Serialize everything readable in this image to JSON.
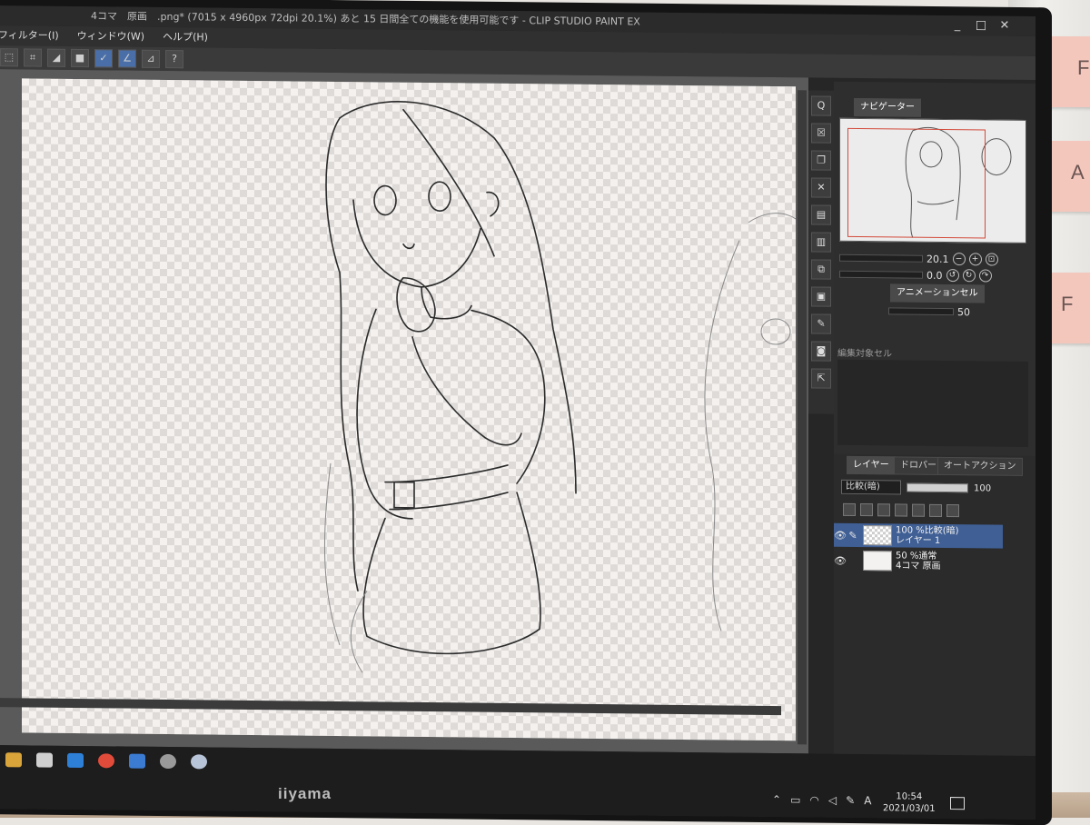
{
  "window": {
    "title": "4コマ　原画　.png* (7015 x 4960px 72dpi 20.1%)  あと 15 日間全ての機能を使用可能です - CLIP STUDIO PAINT EX",
    "minimize": "_",
    "maximize": "□",
    "close": "✕"
  },
  "menu": {
    "items": [
      "フィルター(I)",
      "ウィンドウ(W)",
      "ヘルプ(H)"
    ]
  },
  "navigator": {
    "tab_label": "ナビゲーター",
    "zoom_value": "20.1",
    "rotation_value": "0.0",
    "frame_color": "#d24b3b"
  },
  "animation_cel": {
    "tab_label": "アニメーションセル",
    "value": "50",
    "edit_target_label": "編集対象セル"
  },
  "layer_panel": {
    "tabs": [
      "レイヤー",
      "ドロパー",
      "オートアクション"
    ],
    "blend_mode": "比較(暗)",
    "opacity": "100",
    "layers": [
      {
        "line1": "100 %比較(暗)",
        "line2": "レイヤー 1",
        "selected": true
      },
      {
        "line1": "50 %通常",
        "line2": "4コマ 原画",
        "selected": false
      }
    ],
    "selected_color": "#3f5f95"
  },
  "taskbar": {
    "time": "10:54",
    "date": "2021/03/01",
    "ime": "A",
    "tray_icons": [
      "chevron-up-icon",
      "monitor-icon",
      "wifi-icon",
      "speaker-icon",
      "pen-icon"
    ]
  },
  "monitor": {
    "brand": "iiyama"
  },
  "sticky_notes": [
    "F",
    "A",
    "F"
  ]
}
